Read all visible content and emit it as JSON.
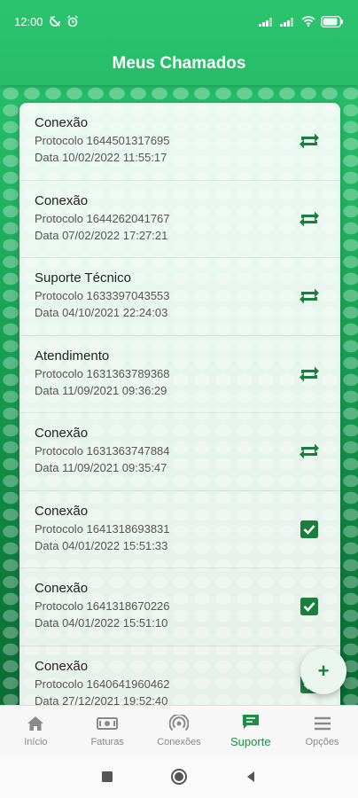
{
  "status_bar": {
    "time": "12:00",
    "battery": "83"
  },
  "header": {
    "title": "Meus Chamados"
  },
  "tickets": [
    {
      "title": "Conexão",
      "protocol": "Protocolo 1644501317695",
      "date": "Data 10/02/2022 11:55:17",
      "status_icon": "repeat-icon"
    },
    {
      "title": "Conexão",
      "protocol": "Protocolo 1644262041767",
      "date": "Data 07/02/2022 17:27:21",
      "status_icon": "repeat-icon"
    },
    {
      "title": "Suporte Técnico",
      "protocol": "Protocolo 1633397043553",
      "date": "Data 04/10/2021 22:24:03",
      "status_icon": "repeat-icon"
    },
    {
      "title": "Atendimento",
      "protocol": "Protocolo 1631363789368",
      "date": "Data 11/09/2021 09:36:29",
      "status_icon": "repeat-icon"
    },
    {
      "title": "Conexão",
      "protocol": "Protocolo 1631363747884",
      "date": "Data 11/09/2021 09:35:47",
      "status_icon": "repeat-icon"
    },
    {
      "title": "Conexão",
      "protocol": "Protocolo 1641318693831",
      "date": "Data 04/01/2022 15:51:33",
      "status_icon": "check-icon"
    },
    {
      "title": "Conexão",
      "protocol": "Protocolo 1641318670226",
      "date": "Data 04/01/2022 15:51:10",
      "status_icon": "check-icon"
    },
    {
      "title": "Conexão",
      "protocol": "Protocolo 1640641960462",
      "date": "Data 27/12/2021 19:52:40",
      "status_icon": "check-icon"
    }
  ],
  "fab": {
    "label": "+"
  },
  "bottom_nav": [
    {
      "label": "Início",
      "icon": "home-icon"
    },
    {
      "label": "Faturas",
      "icon": "bill-icon"
    },
    {
      "label": "Conexões",
      "icon": "signal-icon"
    },
    {
      "label": "Suporte",
      "icon": "chat-icon",
      "active": true
    },
    {
      "label": "Opções",
      "icon": "menu-icon"
    }
  ],
  "colors": {
    "primary": "#22b563",
    "primary_dark": "#0d7d3e",
    "icon_green": "#1a7f3c",
    "nav_active": "#1a8f45"
  }
}
